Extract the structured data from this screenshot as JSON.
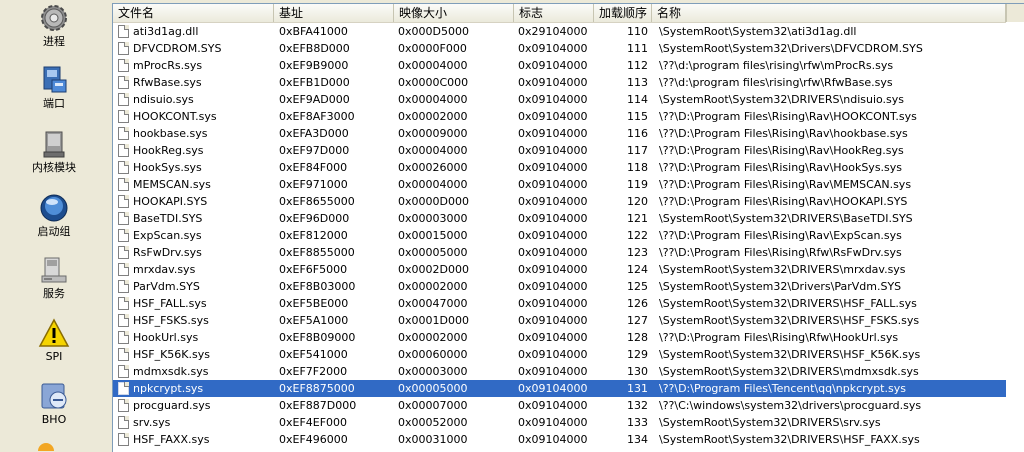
{
  "sidebar": {
    "items": [
      {
        "label": "进程",
        "icon": "gear-icon"
      },
      {
        "label": "端口",
        "icon": "network-port-icon"
      },
      {
        "label": "内核模块",
        "icon": "kernel-module-icon"
      },
      {
        "label": "启动组",
        "icon": "startup-icon"
      },
      {
        "label": "服务",
        "icon": "service-computer-icon"
      },
      {
        "label": "SPI",
        "icon": "warning-icon"
      },
      {
        "label": "BHO",
        "icon": "bho-icon"
      }
    ]
  },
  "table": {
    "columns": [
      "文件名",
      "基址",
      "映像大小",
      "标志",
      "加载顺序",
      "名称"
    ],
    "selected_index": 21,
    "rows": [
      [
        "ati3d1ag.dll",
        "0xBFA41000",
        "0x000D5000",
        "0x29104000",
        "110",
        "\\SystemRoot\\System32\\ati3d1ag.dll"
      ],
      [
        "DFVCDROM.SYS",
        "0xEFB8D000",
        "0x0000F000",
        "0x09104000",
        "111",
        "\\SystemRoot\\System32\\Drivers\\DFVCDROM.SYS"
      ],
      [
        "mProcRs.sys",
        "0xEF9B9000",
        "0x00004000",
        "0x09104000",
        "112",
        "\\??\\d:\\program files\\rising\\rfw\\mProcRs.sys"
      ],
      [
        "RfwBase.sys",
        "0xEFB1D000",
        "0x0000C000",
        "0x09104000",
        "113",
        "\\??\\d:\\program files\\rising\\rfw\\RfwBase.sys"
      ],
      [
        "ndisuio.sys",
        "0xEF9AD000",
        "0x00004000",
        "0x09104000",
        "114",
        "\\SystemRoot\\System32\\DRIVERS\\ndisuio.sys"
      ],
      [
        "HOOKCONT.sys",
        "0xEF8AF3000",
        "0x00002000",
        "0x09104000",
        "115",
        "\\??\\D:\\Program Files\\Rising\\Rav\\HOOKCONT.sys"
      ],
      [
        "hookbase.sys",
        "0xEFA3D000",
        "0x00009000",
        "0x09104000",
        "116",
        "\\??\\D:\\Program Files\\Rising\\Rav\\hookbase.sys"
      ],
      [
        "HookReg.sys",
        "0xEF97D000",
        "0x00004000",
        "0x09104000",
        "117",
        "\\??\\D:\\Program Files\\Rising\\Rav\\HookReg.sys"
      ],
      [
        "HookSys.sys",
        "0xEF84F000",
        "0x00026000",
        "0x09104000",
        "118",
        "\\??\\D:\\Program Files\\Rising\\Rav\\HookSys.sys"
      ],
      [
        "MEMSCAN.sys",
        "0xEF971000",
        "0x00004000",
        "0x09104000",
        "119",
        "\\??\\D:\\Program Files\\Rising\\Rav\\MEMSCAN.sys"
      ],
      [
        "HOOKAPI.SYS",
        "0xEF8655000",
        "0x0000D000",
        "0x09104000",
        "120",
        "\\??\\D:\\Program Files\\Rising\\Rav\\HOOKAPI.SYS"
      ],
      [
        "BaseTDI.SYS",
        "0xEF96D000",
        "0x00003000",
        "0x09104000",
        "121",
        "\\SystemRoot\\System32\\DRIVERS\\BaseTDI.SYS"
      ],
      [
        "ExpScan.sys",
        "0xEF812000",
        "0x00015000",
        "0x09104000",
        "122",
        "\\??\\D:\\Program Files\\Rising\\Rav\\ExpScan.sys"
      ],
      [
        "RsFwDrv.sys",
        "0xEF8855000",
        "0x00005000",
        "0x09104000",
        "123",
        "\\??\\D:\\Program Files\\Rising\\Rfw\\RsFwDrv.sys"
      ],
      [
        "mrxdav.sys",
        "0xEF6F5000",
        "0x0002D000",
        "0x09104000",
        "124",
        "\\SystemRoot\\System32\\DRIVERS\\mrxdav.sys"
      ],
      [
        "ParVdm.SYS",
        "0xEF8B03000",
        "0x00002000",
        "0x09104000",
        "125",
        "\\SystemRoot\\System32\\Drivers\\ParVdm.SYS"
      ],
      [
        "HSF_FALL.sys",
        "0xEF5BE000",
        "0x00047000",
        "0x09104000",
        "126",
        "\\SystemRoot\\System32\\DRIVERS\\HSF_FALL.sys"
      ],
      [
        "HSF_FSKS.sys",
        "0xEF5A1000",
        "0x0001D000",
        "0x09104000",
        "127",
        "\\SystemRoot\\System32\\DRIVERS\\HSF_FSKS.sys"
      ],
      [
        "HookUrl.sys",
        "0xEF8B09000",
        "0x00002000",
        "0x09104000",
        "128",
        "\\??\\D:\\Program Files\\Rising\\Rfw\\HookUrl.sys"
      ],
      [
        "HSF_K56K.sys",
        "0xEF541000",
        "0x00060000",
        "0x09104000",
        "129",
        "\\SystemRoot\\System32\\DRIVERS\\HSF_K56K.sys"
      ],
      [
        "mdmxsdk.sys",
        "0xEF7F2000",
        "0x00003000",
        "0x09104000",
        "130",
        "\\SystemRoot\\System32\\DRIVERS\\mdmxsdk.sys"
      ],
      [
        "npkcrypt.sys",
        "0xEF8875000",
        "0x00005000",
        "0x09104000",
        "131",
        "\\??\\D:\\Program Files\\Tencent\\qq\\npkcrypt.sys"
      ],
      [
        "procguard.sys",
        "0xEF887D000",
        "0x00007000",
        "0x09104000",
        "132",
        "\\??\\C:\\windows\\system32\\drivers\\procguard.sys"
      ],
      [
        "srv.sys",
        "0xEF4EF000",
        "0x00052000",
        "0x09104000",
        "133",
        "\\SystemRoot\\System32\\DRIVERS\\srv.sys"
      ],
      [
        "HSF_FAXX.sys",
        "0xEF496000",
        "0x00031000",
        "0x09104000",
        "134",
        "\\SystemRoot\\System32\\DRIVERS\\HSF_FAXX.sys"
      ]
    ]
  }
}
